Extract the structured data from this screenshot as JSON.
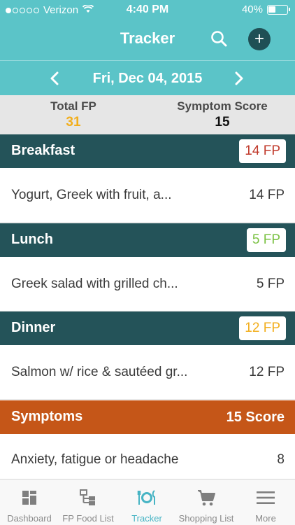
{
  "status_bar": {
    "carrier": "Verizon",
    "time": "4:40 PM",
    "battery": "40%",
    "battery_level": 0.4,
    "signal_bars": 1
  },
  "nav": {
    "title": "Tracker",
    "search_icon": "search-icon",
    "add_icon": "plus-icon",
    "add_label": "+"
  },
  "date_nav": {
    "date": "Fri, Dec 04, 2015",
    "prev_icon": "chevron-left-icon",
    "next_icon": "chevron-right-icon"
  },
  "summary": {
    "total_fp_label": "Total FP",
    "total_fp_value": "31",
    "symptom_score_label": "Symptom Score",
    "symptom_score_value": "15"
  },
  "meals": [
    {
      "title": "Breakfast",
      "badge": "14 FP",
      "badge_color": "#c0392b",
      "item": "Yogurt, Greek with fruit, a...",
      "item_value": "14 FP"
    },
    {
      "title": "Lunch",
      "badge": "5 FP",
      "badge_color": "#7ac143",
      "item": "Greek salad with grilled ch...",
      "item_value": "5 FP"
    },
    {
      "title": "Dinner",
      "badge": "12 FP",
      "badge_color": "#f2ae1c",
      "item": "Salmon w/ rice & sautéed gr...",
      "item_value": "12 FP"
    }
  ],
  "symptoms": {
    "title": "Symptoms",
    "score": "15 Score",
    "item": "Anxiety, fatigue or headache",
    "item_value": "8"
  },
  "tabs": [
    {
      "label": "Dashboard",
      "icon": "dashboard-icon",
      "active": false
    },
    {
      "label": "FP Food List",
      "icon": "food-list-icon",
      "active": false
    },
    {
      "label": "Tracker",
      "icon": "tracker-icon",
      "active": true
    },
    {
      "label": "Shopping List",
      "icon": "cart-icon",
      "active": false
    },
    {
      "label": "More",
      "icon": "menu-icon",
      "active": false
    }
  ],
  "colors": {
    "header_teal": "#5bc4c8",
    "section_dark_teal": "#245359",
    "symptoms_orange": "#c55618",
    "active_tab": "#47b4c4",
    "fp_total": "#f2ae1c"
  }
}
